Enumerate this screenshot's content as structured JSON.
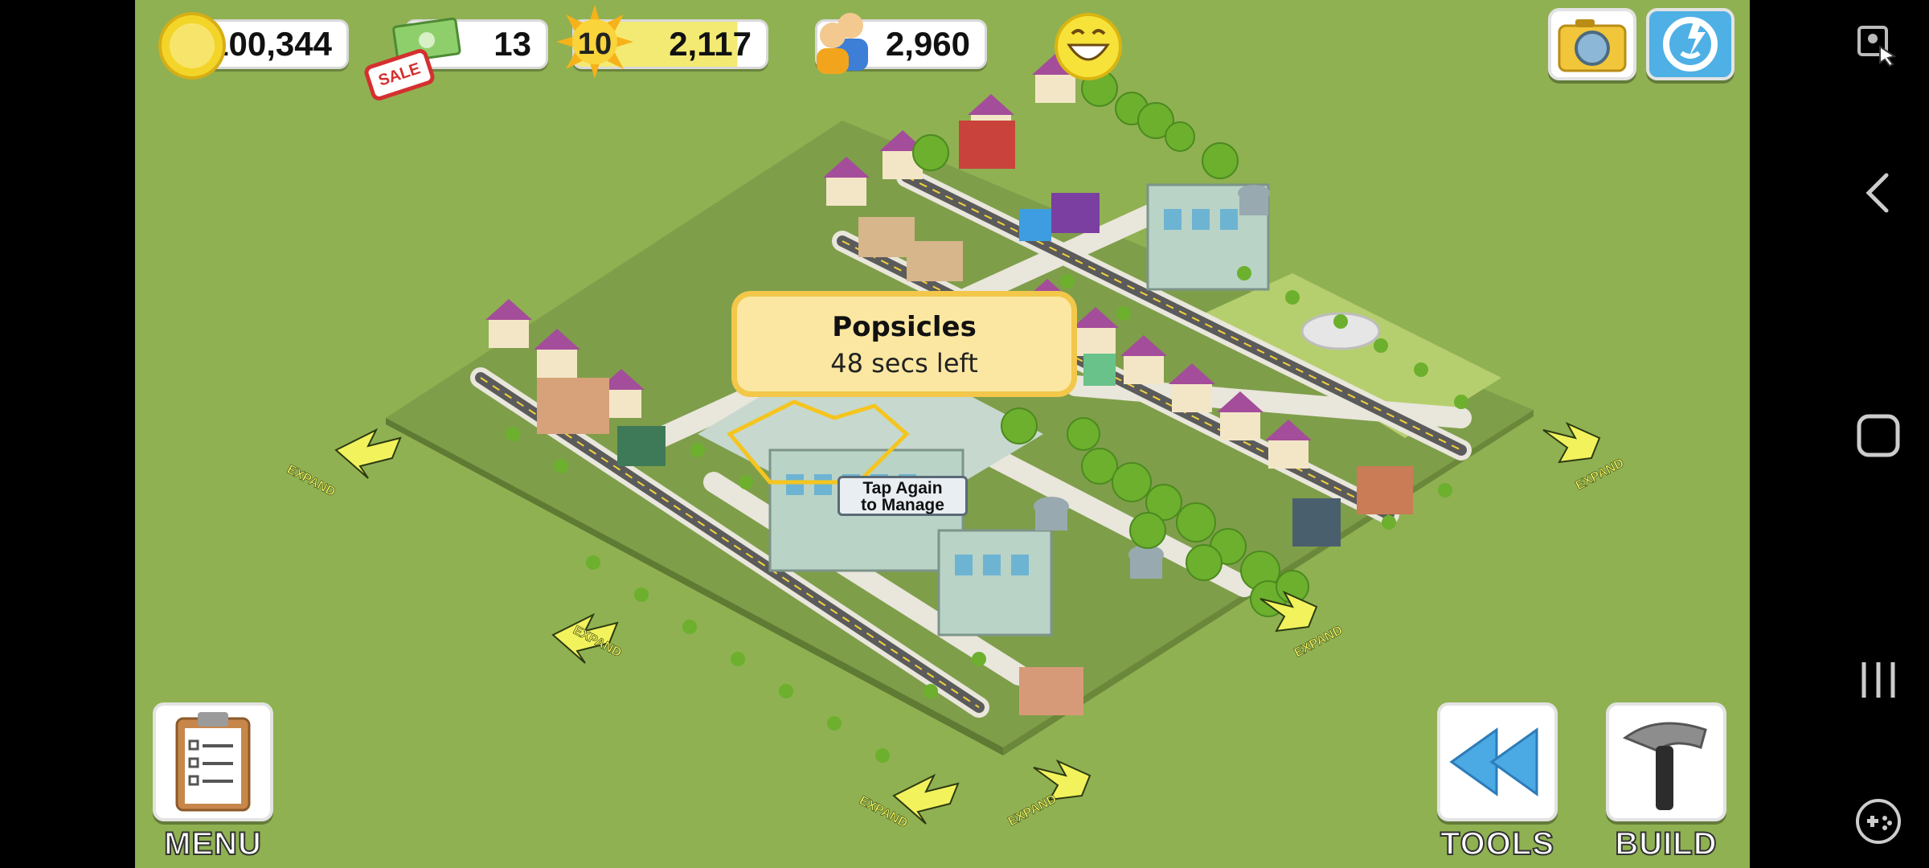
{
  "hud": {
    "coins": "100,344",
    "cash": "13",
    "sale_label": "SALE",
    "level": "10",
    "xp": "2,117",
    "population": "2,960"
  },
  "tooltip": {
    "title": "Popsicles",
    "subtitle": "48 secs left"
  },
  "tap_hint": {
    "line1": "Tap Again",
    "line2": "to Manage"
  },
  "expand_label": "EXPAND",
  "buttons": {
    "menu": "MENU",
    "tools": "TOOLS",
    "build": "BUILD"
  },
  "colors": {
    "grass": "#8fb152",
    "tooltip_bg": "#fbe7a1",
    "tooltip_border": "#f2c74a",
    "xp_bar": "#f3ea74",
    "arrow": "#f2f25c"
  }
}
